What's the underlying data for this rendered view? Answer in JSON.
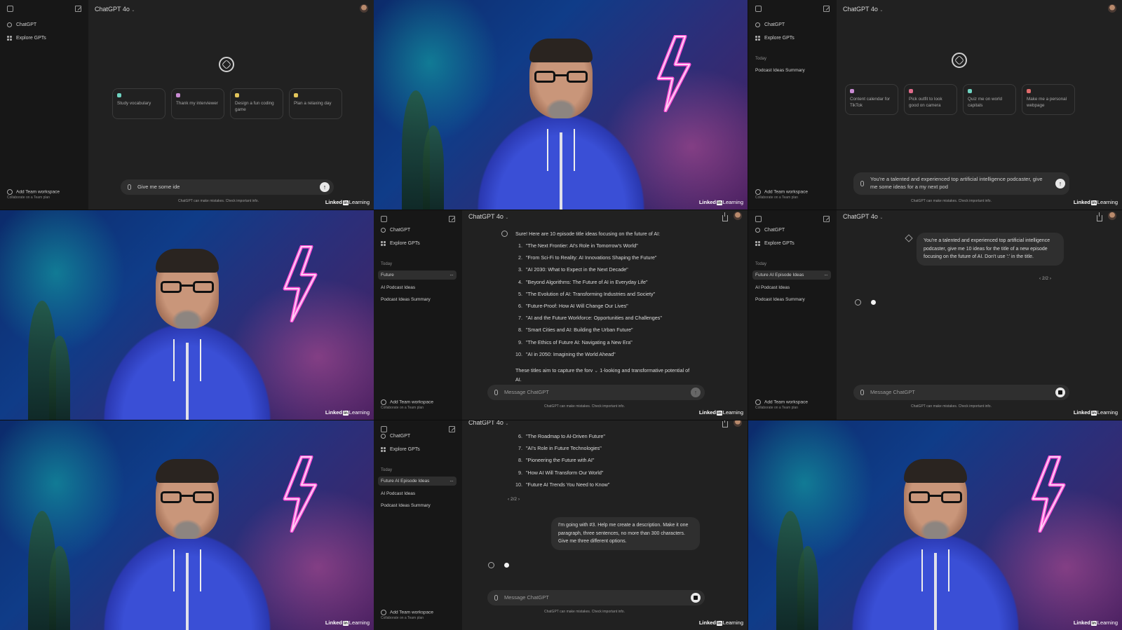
{
  "common": {
    "model_label": "ChatGPT 4o",
    "chevron": "⌄",
    "nav_chatgpt": "ChatGPT",
    "nav_explore": "Explore GPTs",
    "today": "Today",
    "team_title": "Add Team workspace",
    "team_sub": "Collaborate on a Team plan",
    "disclaimer": "ChatGPT can make mistakes. Check important info.",
    "placeholder": "Message ChatGPT",
    "more": "···",
    "send_arrow": "↑",
    "linkedin_a": "Linked",
    "linkedin_in": "in",
    "linkedin_b": "Learning"
  },
  "tile1": {
    "suggestions": [
      "Study vocabulary",
      "Thank my interviewer",
      "Design a fun coding game",
      "Plan a relaxing day"
    ],
    "suggestion_colors": [
      "#6fd3c1",
      "#c98bd3",
      "#e2c55a",
      "#e2c55a"
    ],
    "input_value": "Give me some ide"
  },
  "tile3": {
    "history": [
      "Podcast Ideas Summary"
    ],
    "suggestions": [
      "Content calendar for TikTok",
      "Pick outfit to look good on camera",
      "Quiz me on world capitals",
      "Make me a personal webpage"
    ],
    "suggestion_colors": [
      "#c98bd3",
      "#e06b8a",
      "#6fd3c1",
      "#e06b6b"
    ],
    "input_value": "You're a talented and experienced top artificial intelligence podcaster, give me some ideas for a my next pod"
  },
  "tile5": {
    "history": [
      "Future",
      "AI Podcast Ideas",
      "Podcast Ideas Summary"
    ],
    "intro": "Sure! Here are 10 episode title ideas focusing on the future of AI:",
    "items": [
      "\"The Next Frontier: AI's Role in Tomorrow's World\"",
      "\"From Sci-Fi to Reality: AI Innovations Shaping the Future\"",
      "\"AI 2030: What to Expect in the Next Decade\"",
      "\"Beyond Algorithms: The Future of AI in Everyday Life\"",
      "\"The Evolution of AI: Transforming Industries and Society\"",
      "\"Future-Proof: How AI Will Change Our Lives\"",
      "\"AI and the Future Workforce: Opportunities and Challenges\"",
      "\"Smart Cities and AI: Building the Urban Future\"",
      "\"The Ethics of Future AI: Navigating a New Era\"",
      "\"AI in 2050: Imagining the World Ahead\""
    ],
    "outro_a": "These titles aim to capture the forv",
    "outro_b": "1-looking and transformative potential of",
    "outro_c": "AI."
  },
  "tile6": {
    "history": [
      "Future AI Episode Ideas",
      "AI Podcast Ideas",
      "Podcast Ideas Summary"
    ],
    "user_msg": "You're a talented and experienced top artificial intelligence podcaster, give me 10 ideas for the title of a new episode focusing on the future of AI. Don't use ':' in the title.",
    "pager": "2/2"
  },
  "tile8": {
    "history": [
      "Future AI Episode Ideas",
      "AI Podcast Ideas",
      "Podcast Ideas Summary"
    ],
    "items_start": 6,
    "items": [
      "\"The Roadmap to AI-Driven Future\"",
      "\"AI's Role in Future Technologies\"",
      "\"Pioneering the Future with AI\"",
      "\"How AI Will Transform Our World\"",
      "\"Future AI Trends You Need to Know\""
    ],
    "pager": "2/2",
    "user_msg": "I'm going with #3. Help me create a description. Make it one paragraph, three sentences, no more than 300 characters. Give me three different options."
  }
}
